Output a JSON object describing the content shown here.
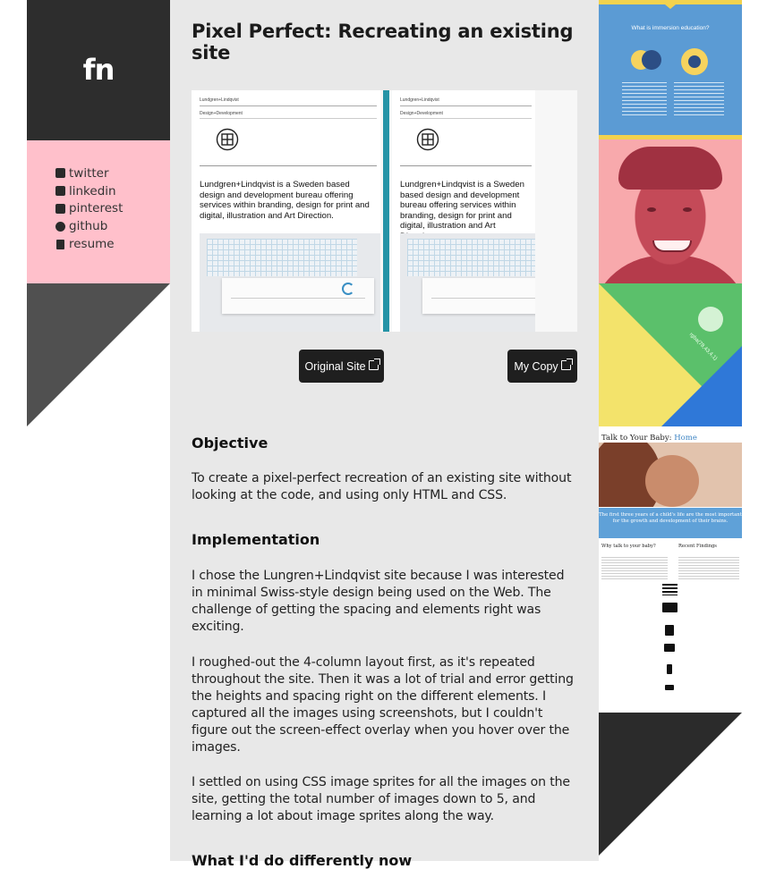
{
  "logo": "fn",
  "social": [
    {
      "icon": "twitter-icon",
      "label": "twitter"
    },
    {
      "icon": "linkedin-icon",
      "label": "linkedin"
    },
    {
      "icon": "pinterest-icon",
      "label": "pinterest"
    },
    {
      "icon": "github-icon",
      "label": "github"
    },
    {
      "icon": "file-icon",
      "label": "resume"
    }
  ],
  "article": {
    "title": "Pixel Perfect: Recreating an existing site",
    "preview": {
      "brand": "Lundgren+Lindqvist",
      "sub": "Design+Development",
      "blurb": "Lundgren+Lindqvist is a Sweden based design and development bureau offering services within branding, design for print and digital, illustration and Art Direction."
    },
    "buttons": {
      "original": "Original Site",
      "copy": "My Copy"
    },
    "sections": [
      {
        "heading": "Objective",
        "paragraphs": [
          "To create a pixel-perfect recreation of an existing site without looking at the code, and using only HTML and CSS."
        ]
      },
      {
        "heading": "Implementation",
        "paragraphs": [
          "I chose the Lungren+Lindqvist site because I was interested in minimal Swiss-style design being used on the Web. The challenge of getting the spacing and elements right was exciting.",
          "I roughed-out the 4-column layout first, as it's repeated throughout the site. Then it was a lot of trial and error getting the heights and spacing right on the different elements. I captured all the images using screenshots, but I couldn't figure out the screen-effect overlay when you hover over the images.",
          "I settled on using CSS image sprites for all the images on the site, getting the total number of images down to 5, and learning a lot about image sprites along the way."
        ]
      },
      {
        "heading": "What I'd do differently now",
        "paragraphs": []
      }
    ]
  },
  "thumbnails": {
    "infographic_title": "What is immersion education?",
    "baby_site_title": "Talk to Your Baby:",
    "baby_site_title_link": "Home",
    "baby_site_band": "The first three years of a child's life are the most important for the growth and development of their brains.",
    "baby_col1": "Why talk to your baby?",
    "baby_col2": "Recent Findings",
    "geo_label": "rgba(78,43,4,1)"
  },
  "colors": {
    "logo_bg": "#2d2d2d",
    "social_bg": "#ffc0cb",
    "main_bg": "#e8e8e8",
    "divider_teal": "#2593a6",
    "button_bg": "#1f1f1f"
  }
}
